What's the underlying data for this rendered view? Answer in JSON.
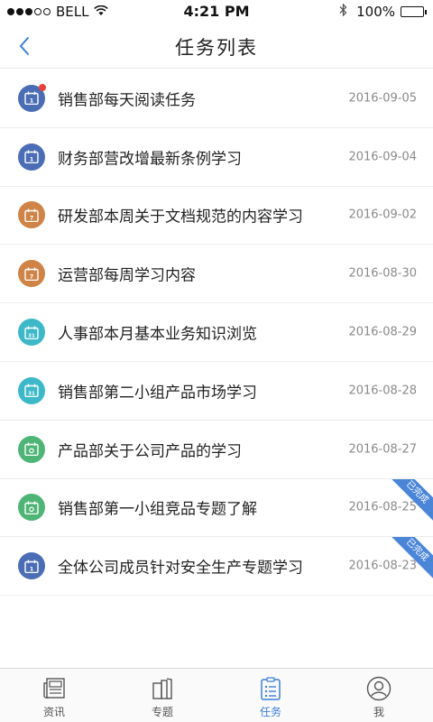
{
  "status_bar": {
    "carrier": "BELL",
    "time": "4:21 PM",
    "battery": "100%"
  },
  "nav": {
    "title": "任务列表",
    "back_icon": "chevron-left-icon"
  },
  "colors": {
    "accent": "#3b7fd8",
    "ribbon": "#4a85d8",
    "unread": "#e8423a",
    "icon_blue": "#4a6db5",
    "icon_orange": "#cf8346",
    "icon_teal": "#3db8c9",
    "icon_green": "#4fb576"
  },
  "tasks": [
    {
      "title": "销售部每天阅读任务",
      "date": "2016-09-05",
      "icon": "calendar-day-icon",
      "icon_color": "#4a6db5",
      "icon_label": "1",
      "unread": true,
      "badge": ""
    },
    {
      "title": "财务部营改增最新条例学习",
      "date": "2016-09-04",
      "icon": "calendar-day-icon",
      "icon_color": "#4a6db5",
      "icon_label": "1",
      "unread": false,
      "badge": ""
    },
    {
      "title": "研发部本周关于文档规范的内容学习",
      "date": "2016-09-02",
      "icon": "calendar-week-icon",
      "icon_color": "#cf8346",
      "icon_label": "7",
      "unread": false,
      "badge": ""
    },
    {
      "title": "运营部每周学习内容",
      "date": "2016-08-30",
      "icon": "calendar-week-icon",
      "icon_color": "#cf8346",
      "icon_label": "7",
      "unread": false,
      "badge": ""
    },
    {
      "title": "人事部本月基本业务知识浏览",
      "date": "2016-08-29",
      "icon": "calendar-month-icon",
      "icon_color": "#3db8c9",
      "icon_label": "31",
      "unread": false,
      "badge": ""
    },
    {
      "title": "销售部第二小组产品市场学习",
      "date": "2016-08-28",
      "icon": "calendar-month-icon",
      "icon_color": "#3db8c9",
      "icon_label": "31",
      "unread": false,
      "badge": ""
    },
    {
      "title": "产品部关于公司产品的学习",
      "date": "2016-08-27",
      "icon": "calendar-camera-icon",
      "icon_color": "#4fb576",
      "icon_label": "",
      "unread": false,
      "badge": ""
    },
    {
      "title": "销售部第一小组竞品专题了解",
      "date": "2016-08-25",
      "icon": "calendar-camera-icon",
      "icon_color": "#4fb576",
      "icon_label": "",
      "unread": false,
      "badge": "已完成"
    },
    {
      "title": "全体公司成员针对安全生产专题学习",
      "date": "2016-08-23",
      "icon": "calendar-day-icon",
      "icon_color": "#4a6db5",
      "icon_label": "1",
      "unread": false,
      "badge": "已完成"
    }
  ],
  "tabs": [
    {
      "label": "资讯",
      "icon": "newspaper-icon",
      "active": false
    },
    {
      "label": "专题",
      "icon": "books-icon",
      "active": false
    },
    {
      "label": "任务",
      "icon": "task-list-icon",
      "active": true
    },
    {
      "label": "我",
      "icon": "user-icon",
      "active": false
    }
  ]
}
